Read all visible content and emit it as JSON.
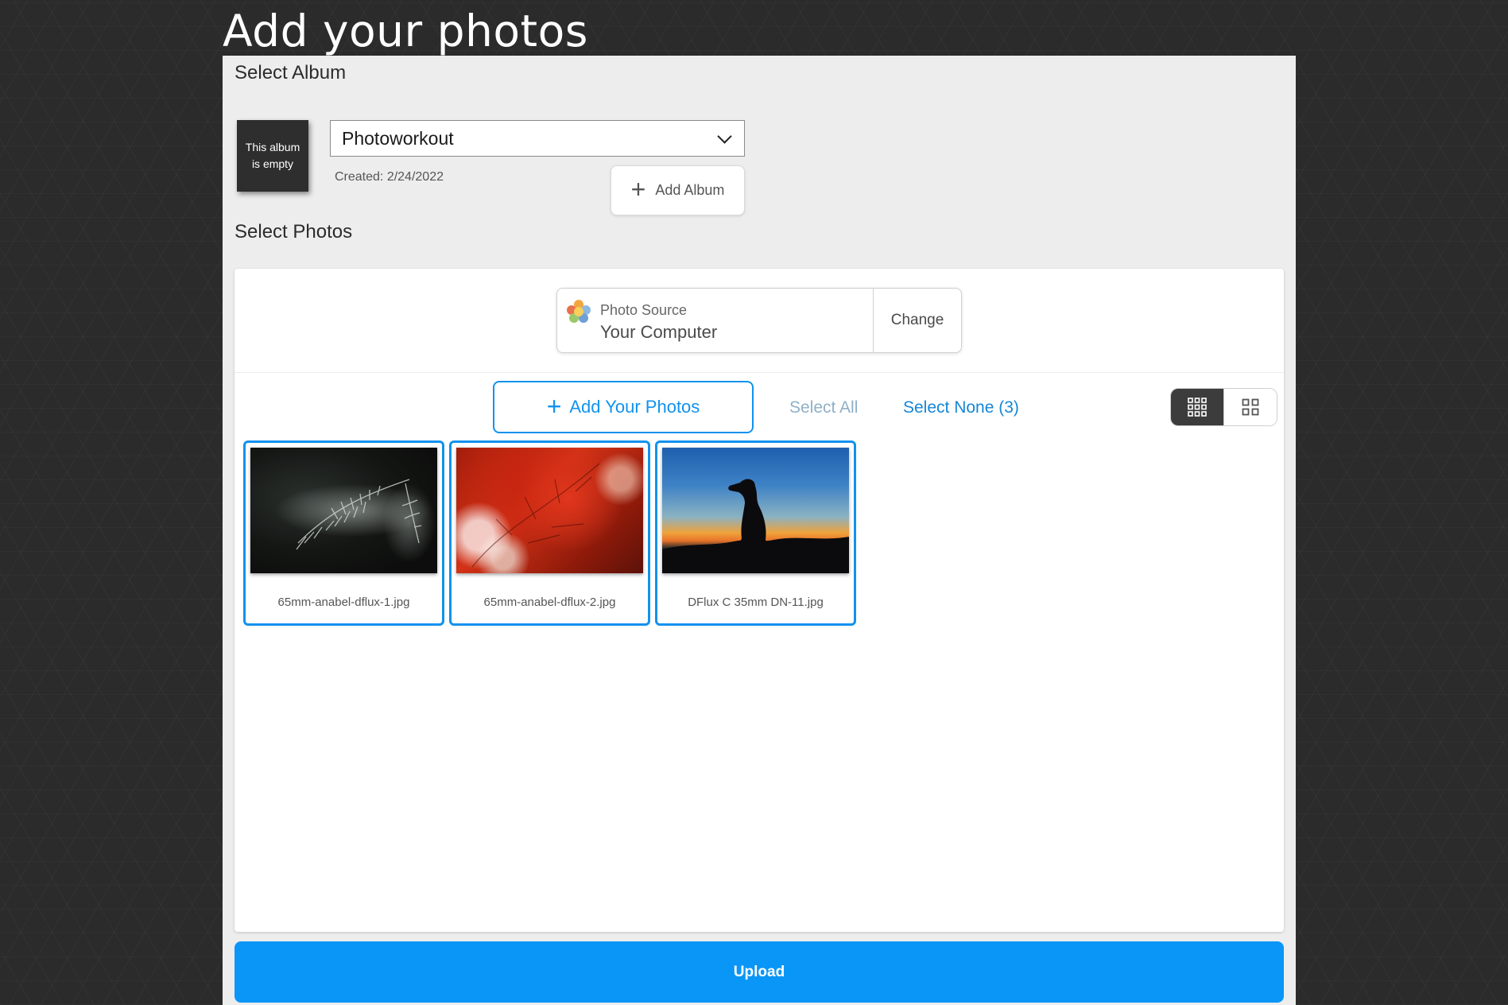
{
  "page": {
    "title": "Add your photos"
  },
  "album": {
    "heading": "Select Album",
    "thumbnail_text": "This album is empty",
    "selected": "Photoworkout",
    "created": "Created: 2/24/2022",
    "add_button": "Add Album"
  },
  "photos": {
    "heading": "Select Photos",
    "source": {
      "label": "Photo Source",
      "value": "Your Computer",
      "change": "Change"
    },
    "add_button": "Add Your Photos",
    "select_all": "Select All",
    "select_none": "Select None (3)",
    "view_modes": [
      "small-grid-icon",
      "large-grid-icon"
    ],
    "active_view": "small-grid",
    "items": [
      {
        "filename": "65mm-anabel-dflux-1.jpg",
        "selected": true
      },
      {
        "filename": "65mm-anabel-dflux-2.jpg",
        "selected": true
      },
      {
        "filename": "DFlux C 35mm DN-11.jpg",
        "selected": true
      }
    ]
  },
  "upload": {
    "label": "Upload"
  },
  "colors": {
    "accent": "#1192ee",
    "upload": "#0a96f7",
    "background": "#2b2b2b",
    "panel": "#ededee"
  }
}
